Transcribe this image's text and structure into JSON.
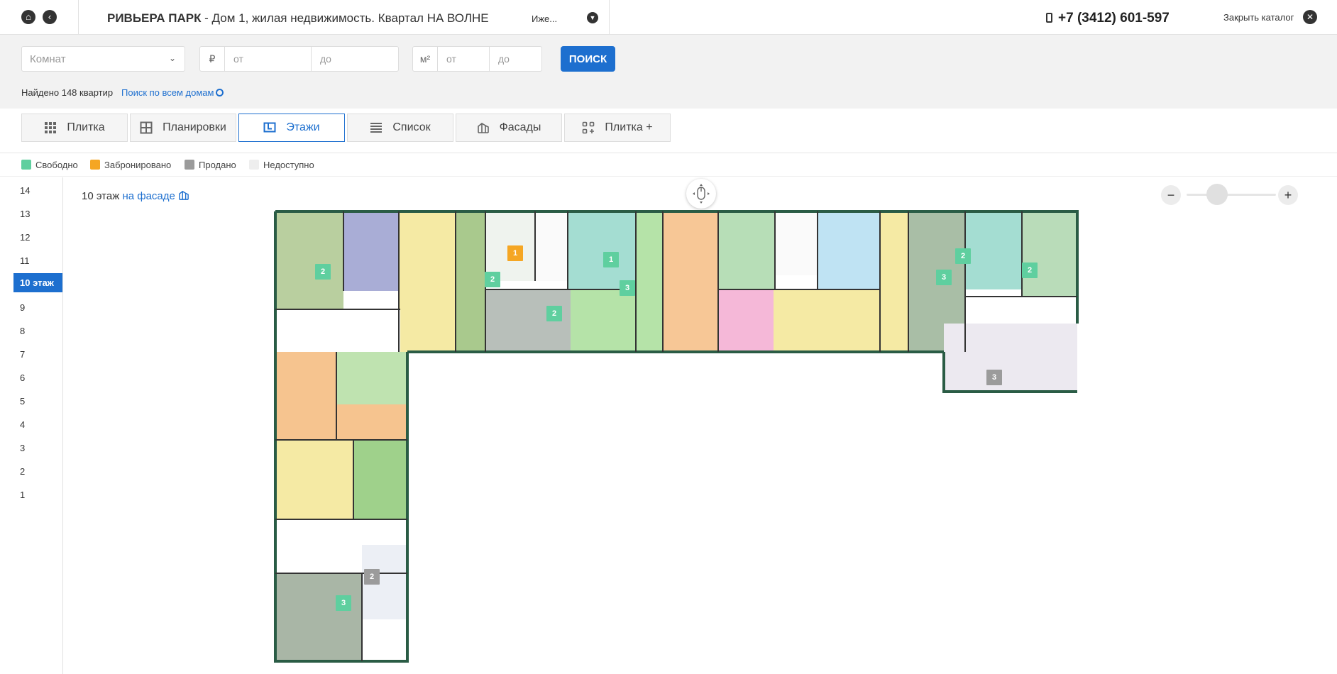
{
  "header": {
    "complex": "РИВЬЕРА ПАРК",
    "subtitle": " - Дом 1, жилая недвижимость. Квартал НА ВОЛНЕ",
    "house_select": "Иже...",
    "phone": "+7 (3412) 601-597",
    "close_label": "Закрыть каталог"
  },
  "filters": {
    "rooms_placeholder": "Комнат",
    "price_unit": "₽",
    "price_from_placeholder": "от",
    "price_to_placeholder": "до",
    "area_unit": "м²",
    "area_from_placeholder": "от",
    "area_to_placeholder": "до",
    "search_label": "ПОИСК",
    "found_text": "Найдено 148 квартир",
    "search_all_label": "Поиск по всем домам"
  },
  "tabs": [
    {
      "label": "Плитка",
      "icon": "grid-icon"
    },
    {
      "label": "Планировки",
      "icon": "layout-icon"
    },
    {
      "label": "Этажи",
      "icon": "floor-icon",
      "active": true
    },
    {
      "label": "Список",
      "icon": "list-icon"
    },
    {
      "label": "Фасады",
      "icon": "facade-icon"
    },
    {
      "label": "Плитка +",
      "icon": "tiles-plus-icon"
    }
  ],
  "legend": [
    {
      "label": "Свободно",
      "color": "#5fcf9f"
    },
    {
      "label": "Забронировано",
      "color": "#f5a623"
    },
    {
      "label": "Продано",
      "color": "#9b9b9b"
    },
    {
      "label": "Недоступно",
      "color": "#eeeeee"
    }
  ],
  "floors": {
    "items": [
      "14",
      "13",
      "12",
      "11",
      "10 этаж",
      "9",
      "8",
      "7",
      "6",
      "5",
      "4",
      "3",
      "2",
      "1"
    ],
    "active_index": 4
  },
  "floor_view": {
    "title": "10 этаж",
    "facade_link": "на фасаде"
  },
  "zoom": {
    "minus": "−",
    "plus": "+"
  },
  "plan_badges": [
    {
      "value": "1",
      "status": "booked"
    },
    {
      "value": "2",
      "status": "free"
    },
    {
      "value": "2",
      "status": "free"
    },
    {
      "value": "1",
      "status": "free"
    },
    {
      "value": "3",
      "status": "free"
    },
    {
      "value": "2",
      "status": "free"
    },
    {
      "value": "2",
      "status": "free"
    },
    {
      "value": "3",
      "status": "free"
    },
    {
      "value": "2",
      "status": "free"
    },
    {
      "value": "3",
      "status": "sold"
    },
    {
      "value": "2",
      "status": "sold"
    },
    {
      "value": "3",
      "status": "free"
    }
  ],
  "colors": {
    "accent": "#1d6fcf",
    "free": "#5fcf9f",
    "booked": "#f5a623",
    "sold": "#9b9b9b"
  }
}
